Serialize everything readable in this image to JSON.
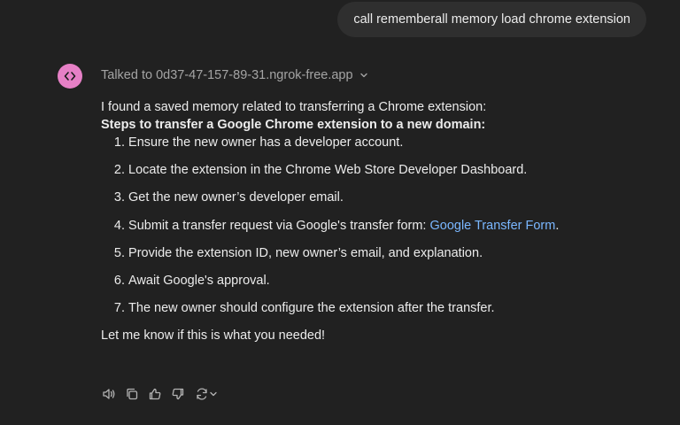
{
  "user_message": "call rememberall memory load chrome extension",
  "assistant": {
    "avatar_icon": "code-brackets-icon",
    "tool_call_text": "Talked to 0d37-47-157-89-31.ngrok-free.app",
    "intro": "I found a saved memory related to transferring a Chrome extension:",
    "heading": "Steps to transfer a Google Chrome extension to a new domain:",
    "steps": [
      {
        "num": "1.",
        "text": "Ensure the new owner has a developer account."
      },
      {
        "num": "2.",
        "text": "Locate the extension in the Chrome Web Store Developer Dashboard."
      },
      {
        "num": "3.",
        "text": "Get the new owner’s developer email."
      },
      {
        "num": "4.",
        "text": "Submit a transfer request via Google's transfer form: ",
        "link": "Google Transfer Form",
        "after": "."
      },
      {
        "num": "5.",
        "text": "Provide the extension ID, new owner’s email, and explanation."
      },
      {
        "num": "6.",
        "text": "Await Google's approval."
      },
      {
        "num": "7.",
        "text": "The new owner should configure the extension after the transfer."
      }
    ],
    "closing": "Let me know if this is what you needed!"
  },
  "actions": [
    "speaker-icon",
    "copy-icon",
    "thumbs-up-icon",
    "thumbs-down-icon",
    "regenerate-icon"
  ],
  "colors": {
    "background": "#212121",
    "bubble": "#2f2f2f",
    "avatar": "#e680c6",
    "link": "#7ab7ff",
    "muted": "#a4a4a4"
  }
}
